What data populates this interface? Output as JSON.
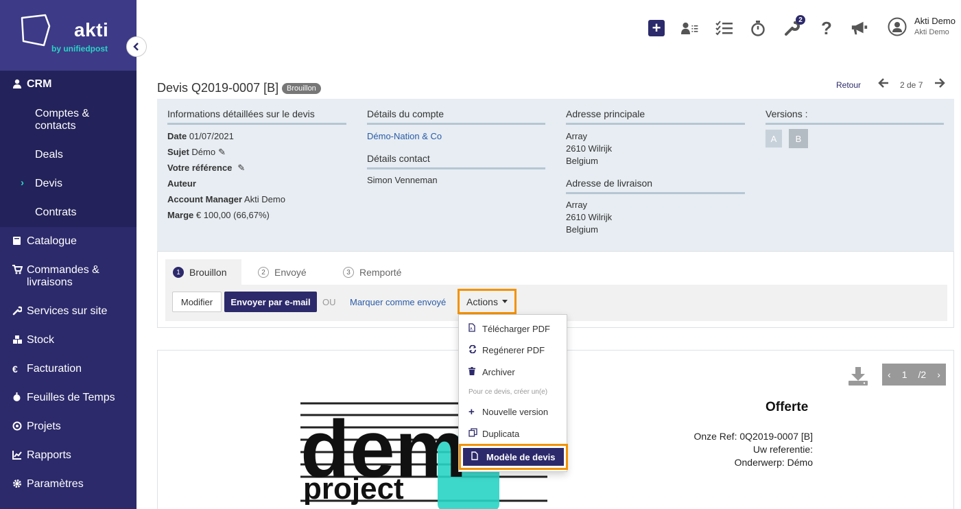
{
  "brand": {
    "name": "akti",
    "sub": "by unifiedpost"
  },
  "sidebar": {
    "crm_label": "CRM",
    "crm_items": [
      "Comptes &\ncontacts",
      "Deals",
      "Devis",
      "Contrats"
    ],
    "items": [
      {
        "label": "Catalogue",
        "icon": "book-icon"
      },
      {
        "label": "Commandes &\nlivraisons",
        "icon": "cart-icon"
      },
      {
        "label": "Services sur site",
        "icon": "wrench-icon"
      },
      {
        "label": "Stock",
        "icon": "boxes-icon"
      },
      {
        "label": "Facturation",
        "icon": "euro-icon"
      },
      {
        "label": "Feuilles de Temps",
        "icon": "stopwatch-icon"
      },
      {
        "label": "Projets",
        "icon": "target-icon"
      },
      {
        "label": "Rapports",
        "icon": "chart-icon"
      },
      {
        "label": "Paramètres",
        "icon": "gear-icon"
      }
    ]
  },
  "topbar": {
    "wrench_badge": "2",
    "user_name": "Akti Demo",
    "user_company": "Akti Demo"
  },
  "header": {
    "title": "Devis Q2019-0007 [B]",
    "status": "Brouillon",
    "retour": "Retour",
    "pager": "2 de 7"
  },
  "info": {
    "col1_title": "Informations détaillées sur le devis",
    "date_label": "Date",
    "date_value": "01/07/2021",
    "sujet_label": "Sujet",
    "sujet_value": "Démo",
    "ref_label": "Votre référence",
    "auteur_label": "Auteur",
    "am_label": "Account Manager",
    "am_value": "Akti Demo",
    "marge_label": "Marge",
    "marge_value": "€ 100,00 (66,67%)",
    "col2_title": "Détails du compte",
    "account_link": "Démo-Nation & Co",
    "contact_title": "Détails contact",
    "contact_name": "Simon Venneman",
    "col3_title": "Adresse principale",
    "addr1": [
      "Array",
      "2610 Wilrijk",
      "Belgium"
    ],
    "delivery_title": "Adresse de livraison",
    "addr2": [
      "Array",
      "2610 Wilrijk",
      "Belgium"
    ],
    "col4_title": "Versions :",
    "versions": [
      "A",
      "B"
    ]
  },
  "workflow": {
    "steps": [
      {
        "num": "1",
        "label": "Brouillon"
      },
      {
        "num": "2",
        "label": "Envoyé"
      },
      {
        "num": "3",
        "label": "Remporté"
      }
    ],
    "modifier": "Modifier",
    "send_email": "Envoyer par e-mail",
    "ou": "OU",
    "mark_sent": "Marquer comme envoyé",
    "actions": "Actions"
  },
  "dropdown": {
    "items": [
      "Télécharger PDF",
      "Regénerer PDF",
      "Archiver"
    ],
    "header": "Pour ce devis, créer un(e)",
    "create_items": [
      "Nouvelle version",
      "Duplicata"
    ],
    "highlight": "Modèle de devis"
  },
  "document": {
    "page_current": "1",
    "page_total": "/2",
    "title": "Offerte",
    "lines": [
      "Onze Ref: 0Q2019-0007 [B]",
      "Uw referentie:",
      "Onderwerp: Démo"
    ],
    "logo_text_top": "dem",
    "logo_text_bottom": "project"
  }
}
